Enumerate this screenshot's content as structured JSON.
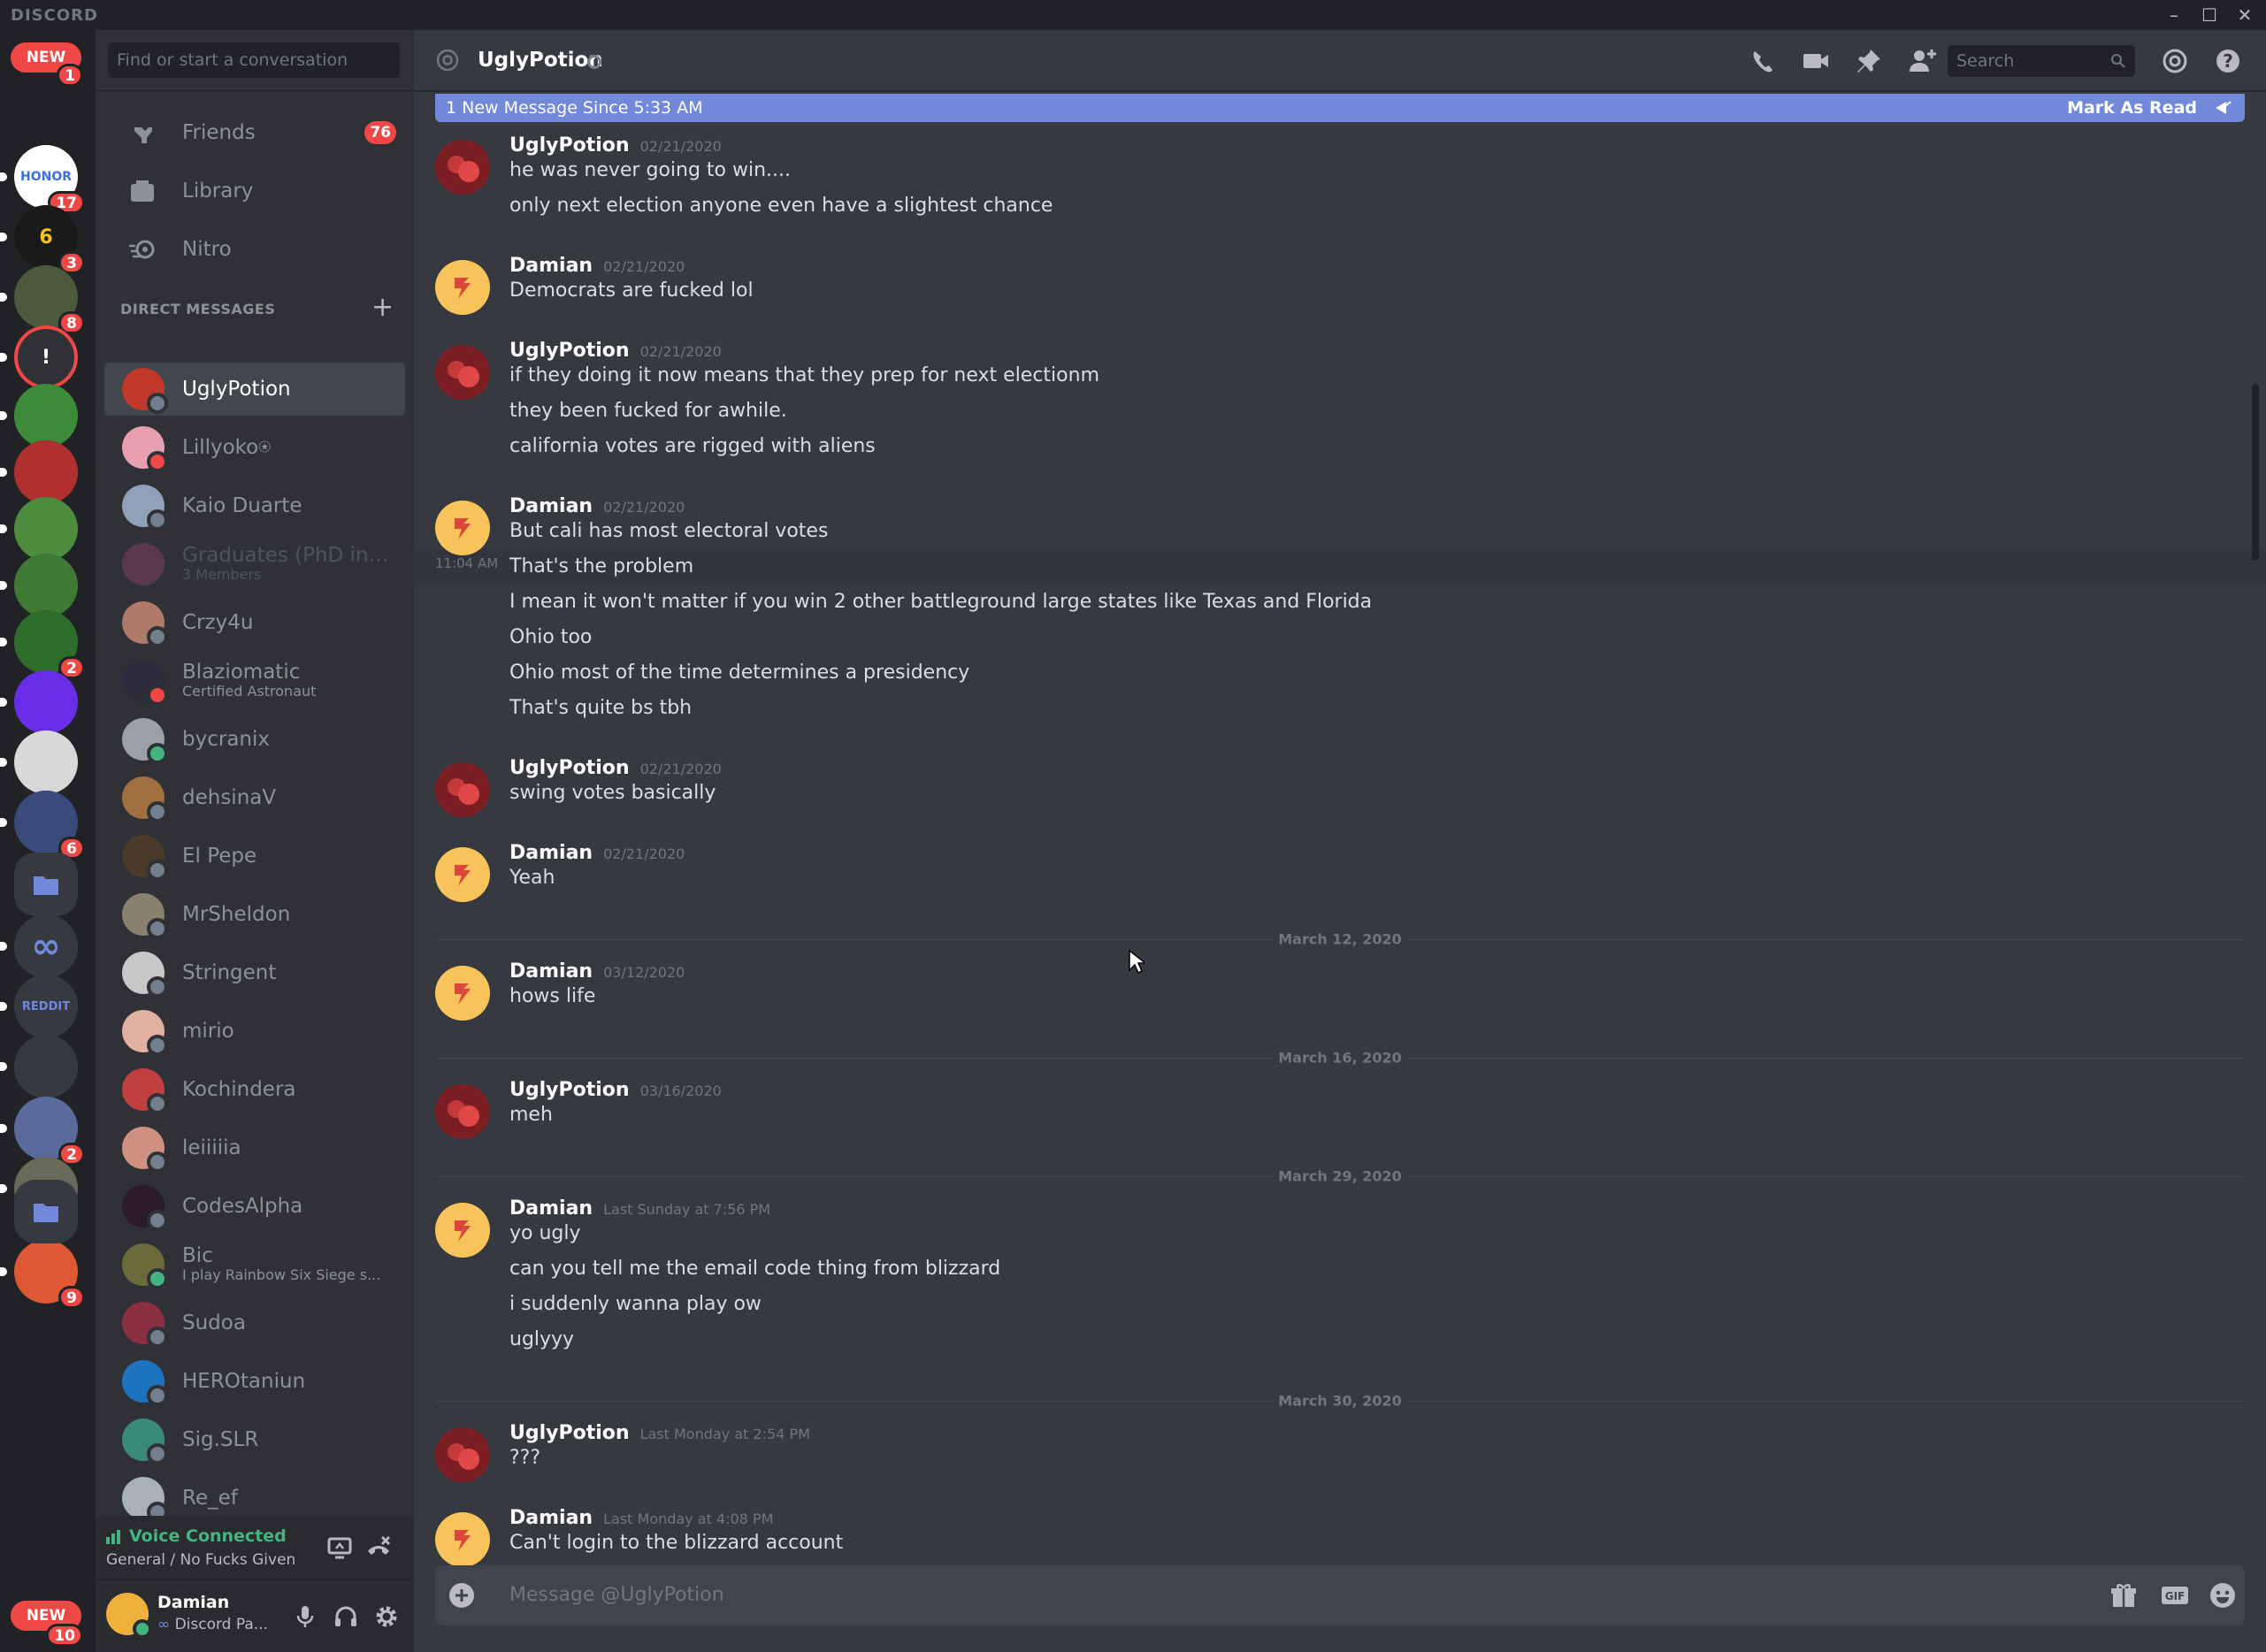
{
  "window": {
    "app_name": "DISCORD",
    "controls": [
      "minimize",
      "maximize",
      "close"
    ]
  },
  "servers": {
    "top_pill": {
      "label": "NEW",
      "badge": "1"
    },
    "items": [
      {
        "label": "HONOR",
        "badge": "17",
        "color": "#ffffff",
        "text_color": "#3a6ee8"
      },
      {
        "label": "6",
        "badge": "3",
        "color": "#1a1a1a",
        "text_color": "#f5c518"
      },
      {
        "label": "",
        "badge": "8",
        "color": "#4a5a3a"
      },
      {
        "label": "!",
        "badge": "",
        "color": "#2f3136",
        "text_color": "#ffffff",
        "ring": "#f04747"
      },
      {
        "label": "",
        "badge": "",
        "color": "#3c8a3a"
      },
      {
        "label": "",
        "badge": "",
        "color": "#b03030"
      },
      {
        "label": "",
        "badge": "",
        "color": "#4c8c3c"
      },
      {
        "label": "",
        "badge": "",
        "color": "#3f7a35"
      },
      {
        "label": "",
        "badge": "2",
        "color": "#2d6e2a"
      },
      {
        "label": "",
        "badge": "",
        "color": "#6a2ee8"
      },
      {
        "label": "",
        "badge": "",
        "color": "#d8d8d8"
      },
      {
        "label": "",
        "badge": "6",
        "color": "#3a4a7a"
      }
    ],
    "folder_icon": "folder-icon",
    "extra": [
      {
        "label": "∞",
        "badge": "",
        "color": "#36393f",
        "text_color": "#7289da"
      },
      {
        "label": "REDDIT",
        "badge": "",
        "color": "#36393f",
        "text_color": "#7289da"
      },
      {
        "label": "",
        "badge": "",
        "color": "#36393f"
      },
      {
        "label": "",
        "badge": "2",
        "color": "#5a6a9a"
      },
      {
        "label": "",
        "badge": "",
        "color": "#6a6a5a"
      },
      {
        "label": "",
        "badge": "9",
        "color": "#de5833"
      }
    ],
    "bottom_pill": {
      "label": "NEW",
      "badge": "10"
    }
  },
  "sidebar": {
    "search_placeholder": "Find or start a conversation",
    "nav": [
      {
        "label": "Friends",
        "icon": "friends-icon",
        "badge": "76"
      },
      {
        "label": "Library",
        "icon": "library-icon",
        "badge": ""
      },
      {
        "label": "Nitro",
        "icon": "nitro-icon",
        "badge": ""
      }
    ],
    "dm_header": "DIRECT MESSAGES",
    "dms": [
      {
        "name": "UglyPotion",
        "sub": "",
        "color": "#c0392b",
        "status": "#747f8d",
        "active": true
      },
      {
        "name": "Lillyoko⍟",
        "sub": "",
        "color": "#e8a0b0",
        "status": "#f04747"
      },
      {
        "name": "Kaio Duarte",
        "sub": "",
        "color": "#8fa0b8",
        "status": "#747f8d"
      },
      {
        "name": "Graduates (PhD in A...",
        "sub": "3 Members",
        "color": "#5a3a4a",
        "status": "",
        "muted": true
      },
      {
        "name": "Crzy4u",
        "sub": "",
        "color": "#b07a6a",
        "status": "#747f8d"
      },
      {
        "name": "Blaziomatic",
        "sub": "Certified Astronaut",
        "color": "#2c2c3a",
        "status": "#f04747"
      },
      {
        "name": "bycranix",
        "sub": "",
        "color": "#9aa0a6",
        "status": "#43b581"
      },
      {
        "name": "dehsinaV",
        "sub": "",
        "color": "#a07040",
        "status": "#747f8d"
      },
      {
        "name": "El Pepe",
        "sub": "",
        "color": "#4a3a2a",
        "status": "#747f8d"
      },
      {
        "name": "MrSheldon",
        "sub": "",
        "color": "#8a8070",
        "status": "#747f8d"
      },
      {
        "name": "Stringent",
        "sub": "",
        "color": "#c8c8c8",
        "status": "#747f8d"
      },
      {
        "name": "mirio",
        "sub": "",
        "color": "#e0b0a0",
        "status": "#747f8d"
      },
      {
        "name": "Kochindera",
        "sub": "",
        "color": "#c04040",
        "status": "#747f8d"
      },
      {
        "name": "leiiiiia",
        "sub": "",
        "color": "#d09080",
        "status": "#747f8d"
      },
      {
        "name": "CodesAlpha",
        "sub": "",
        "color": "#2a1a2a",
        "status": "#747f8d"
      },
      {
        "name": "Bic",
        "sub": "I play Rainbow Six Siege s...",
        "color": "#6a6a3a",
        "status": "#43b581"
      },
      {
        "name": "Sudoa",
        "sub": "",
        "color": "#8a3040",
        "status": "#747f8d"
      },
      {
        "name": "HEROtaniun",
        "sub": "",
        "color": "#1e73be",
        "status": "#747f8d"
      },
      {
        "name": "Sig.SLR",
        "sub": "",
        "color": "#3a8a7a",
        "status": "#747f8d"
      },
      {
        "name": "Re_ef",
        "sub": "",
        "color": "#a8b0b8",
        "status": "#747f8d"
      }
    ],
    "voice": {
      "title": "Voice Connected",
      "channel": "General / No Fucks Given"
    },
    "user": {
      "name": "Damian",
      "status": "Discord Pa..."
    }
  },
  "chat": {
    "title": "UglyPotion",
    "search_placeholder": "Search",
    "new_bar": {
      "text": "1 New Message Since 5:33 AM",
      "action": "Mark As Read"
    },
    "author_colors": {
      "UglyPotion": "#ffffff",
      "Damian": "#ffffff"
    },
    "groups": [
      {
        "author": "UglyPotion",
        "time": "02/21/2020",
        "lines": [
          "he was never going to win....",
          "only next election anyone even have a slightest chance"
        ]
      },
      {
        "author": "Damian",
        "time": "02/21/2020",
        "lines": [
          "Democrats are fucked lol"
        ]
      },
      {
        "author": "UglyPotion",
        "time": "02/21/2020",
        "lines": [
          "if they doing it now means that they prep for next electionm",
          "they been fucked for awhile.",
          "california votes are rigged with aliens"
        ]
      },
      {
        "author": "Damian",
        "time": "02/21/2020",
        "lines": [
          "But cali has most electoral votes",
          "That's the problem",
          "I mean it won't matter if you win 2 other battleground large states like Texas and Florida",
          "Ohio too",
          "Ohio most of the time determines a presidency",
          "That's quite bs tbh"
        ],
        "hover_time": "11:04 AM"
      },
      {
        "author": "UglyPotion",
        "time": "02/21/2020",
        "lines": [
          "swing votes basically"
        ]
      },
      {
        "author": "Damian",
        "time": "02/21/2020",
        "lines": [
          "Yeah"
        ]
      },
      {
        "divider": "March 12, 2020"
      },
      {
        "author": "Damian",
        "time": "03/12/2020",
        "lines": [
          "hows life"
        ]
      },
      {
        "divider": "March 16, 2020"
      },
      {
        "author": "UglyPotion",
        "time": "03/16/2020",
        "lines": [
          "meh"
        ]
      },
      {
        "divider": "March 29, 2020"
      },
      {
        "author": "Damian",
        "time": "Last Sunday at 7:56 PM",
        "lines": [
          "yo ugly",
          "can you tell me the email code thing from blizzard",
          "i suddenly wanna play ow",
          "uglyyy"
        ]
      },
      {
        "divider": "March 30, 2020"
      },
      {
        "author": "UglyPotion",
        "time": "Last Monday at 2:54 PM",
        "lines": [
          "???"
        ]
      },
      {
        "author": "Damian",
        "time": "Last Monday at 4:08 PM",
        "lines": [
          "Can't login to the blizzard account"
        ]
      }
    ],
    "composer_placeholder": "Message @UglyPotion"
  }
}
